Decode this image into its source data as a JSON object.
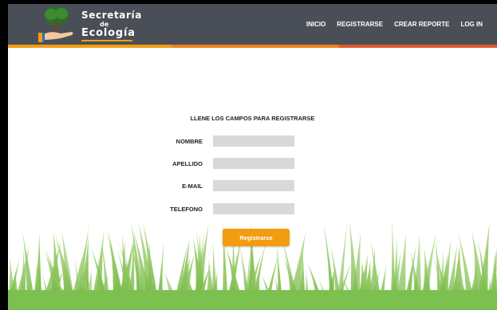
{
  "brand": {
    "line1": "Secretaría",
    "line2": "de",
    "line3": "Ecología"
  },
  "nav": {
    "items": [
      "INICIO",
      "REGISTRARSE",
      "CREAR REPORTE",
      "LOG IN"
    ]
  },
  "form": {
    "title": "LLENE LOS CAMPOS PARA REGISTRARSE",
    "fields": [
      {
        "label": "NOMBRE",
        "value": ""
      },
      {
        "label": "APELLIDO",
        "value": ""
      },
      {
        "label": "E-MAIL",
        "value": ""
      },
      {
        "label": "TELEFONO",
        "value": ""
      }
    ],
    "submit_label": "Registrarse"
  },
  "colors": {
    "header": "#4a4f57",
    "accent_orange": "#f39c12",
    "accent_red": "#e4572e",
    "field": "#d9d9d9",
    "grass": "#7cc04f"
  }
}
